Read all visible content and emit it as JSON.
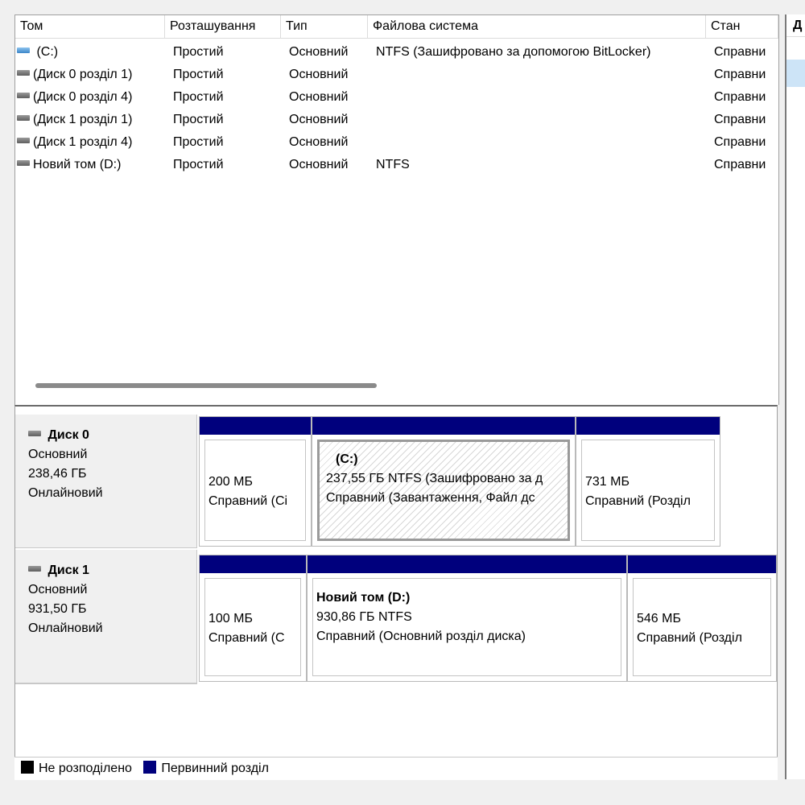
{
  "columns": [
    "Том",
    "Розташування",
    "Тип",
    "Файлова система",
    "Стан"
  ],
  "right_column_header": "Д",
  "volumes": [
    {
      "name": "(C:)",
      "icon": "drive-icon-system",
      "layout": "Простий",
      "type": "Основний",
      "fs": "NTFS (Зашифровано за допомогою BitLocker)",
      "status": "Справни"
    },
    {
      "name": "(Диск 0 розділ 1)",
      "icon": "drive-icon",
      "layout": "Простий",
      "type": "Основний",
      "fs": "",
      "status": "Справни"
    },
    {
      "name": "(Диск 0 розділ 4)",
      "icon": "drive-icon",
      "layout": "Простий",
      "type": "Основний",
      "fs": "",
      "status": "Справни"
    },
    {
      "name": "(Диск 1 розділ 1)",
      "icon": "drive-icon",
      "layout": "Простий",
      "type": "Основний",
      "fs": "",
      "status": "Справни"
    },
    {
      "name": "(Диск 1 розділ 4)",
      "icon": "drive-icon",
      "layout": "Простий",
      "type": "Основний",
      "fs": "",
      "status": "Справни"
    },
    {
      "name": "Новий том (D:)",
      "icon": "drive-icon",
      "layout": "Простий",
      "type": "Основний",
      "fs": "NTFS",
      "status": "Справни"
    }
  ],
  "disks": [
    {
      "title": "Диск 0",
      "kind": "Основний",
      "size": "238,46 ГБ",
      "state": "Онлайновий",
      "partitions": [
        {
          "name": "",
          "line1": "200 МБ",
          "line2": "Справний (Сі"
        },
        {
          "name": "(C:)",
          "line1": "237,55 ГБ NTFS (Зашифровано за д",
          "line2": "Справний (Завантаження, Файл дс"
        },
        {
          "name": "",
          "line1": "731 МБ",
          "line2": "Справний (Розділ"
        }
      ]
    },
    {
      "title": "Диск 1",
      "kind": "Основний",
      "size": "931,50 ГБ",
      "state": "Онлайновий",
      "partitions": [
        {
          "name": "",
          "line1": "100 МБ",
          "line2": "Справний (С"
        },
        {
          "name": "Новий том  (D:)",
          "line1": "930,86 ГБ NTFS",
          "line2": "Справний (Основний розділ диска)"
        },
        {
          "name": "",
          "line1": "546 МБ",
          "line2": "Справний (Розділ"
        }
      ]
    }
  ],
  "legend": [
    {
      "label": "Не розподілено",
      "color": "#000000"
    },
    {
      "label": "Первинний розділ",
      "color": "#00007d"
    }
  ],
  "colors": {
    "primary_partition_bar": "#00007d",
    "selection": "#cde4f7"
  }
}
